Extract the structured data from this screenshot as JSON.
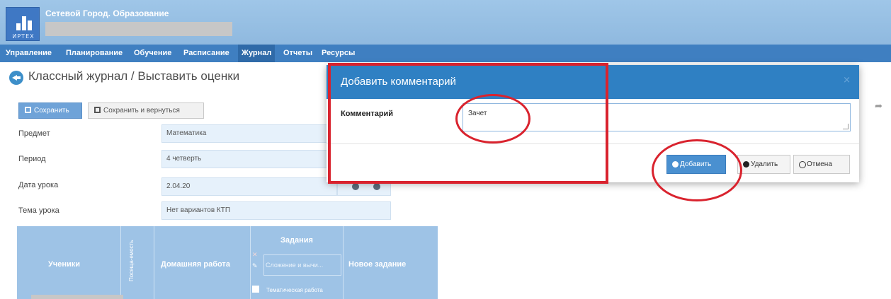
{
  "app": {
    "title": "Сетевой Город. Образование",
    "brand": "ИРТЕХ"
  },
  "nav": {
    "items": [
      "Управление",
      "Планирование",
      "Обучение",
      "Расписание",
      "Журнал",
      "Отчеты",
      "Ресурсы"
    ],
    "active": "Журнал"
  },
  "page": {
    "title": "Классный журнал / Выставить оценки"
  },
  "toolbar": {
    "save_label": "Сохранить",
    "save_return_label": "Сохранить и вернуться"
  },
  "form": {
    "subject_label": "Предмет",
    "subject_value": "Математика",
    "period_label": "Период",
    "period_value": "4 четверть",
    "date_label": "Дата урока",
    "date_value": "2.04.20",
    "topic_label": "Тема урока",
    "topic_value": "Нет вариантов КТП"
  },
  "table": {
    "students_header": "Ученики",
    "attendance_header": "Посеща-емость",
    "homework_header": "Домашняя работа",
    "tasks_header": "Задания",
    "task_name": "Сложение и вычи...",
    "task_type": "Тематическая работа",
    "new_task_header": "Новое задание"
  },
  "modal": {
    "title": "Добавить комментарий",
    "close_glyph": "×",
    "comment_label": "Комментарий",
    "comment_value": "Зачет",
    "add_label": "Добавить",
    "delete_label": "Удалить",
    "cancel_label": "Отмена"
  },
  "colors": {
    "header": "#9fc6e8",
    "nav": "#3f7fc1",
    "modal_header": "#2f80c3",
    "primary_button": "#4a90d0",
    "annotation": "#d9232e"
  },
  "icons": {
    "back": "back-arrow-icon",
    "save": "floppy-disk-icon",
    "add": "plus-circle-icon",
    "delete": "minus-circle-icon",
    "cancel": "cancel-circle-icon",
    "side": "share-arrow-icon"
  }
}
